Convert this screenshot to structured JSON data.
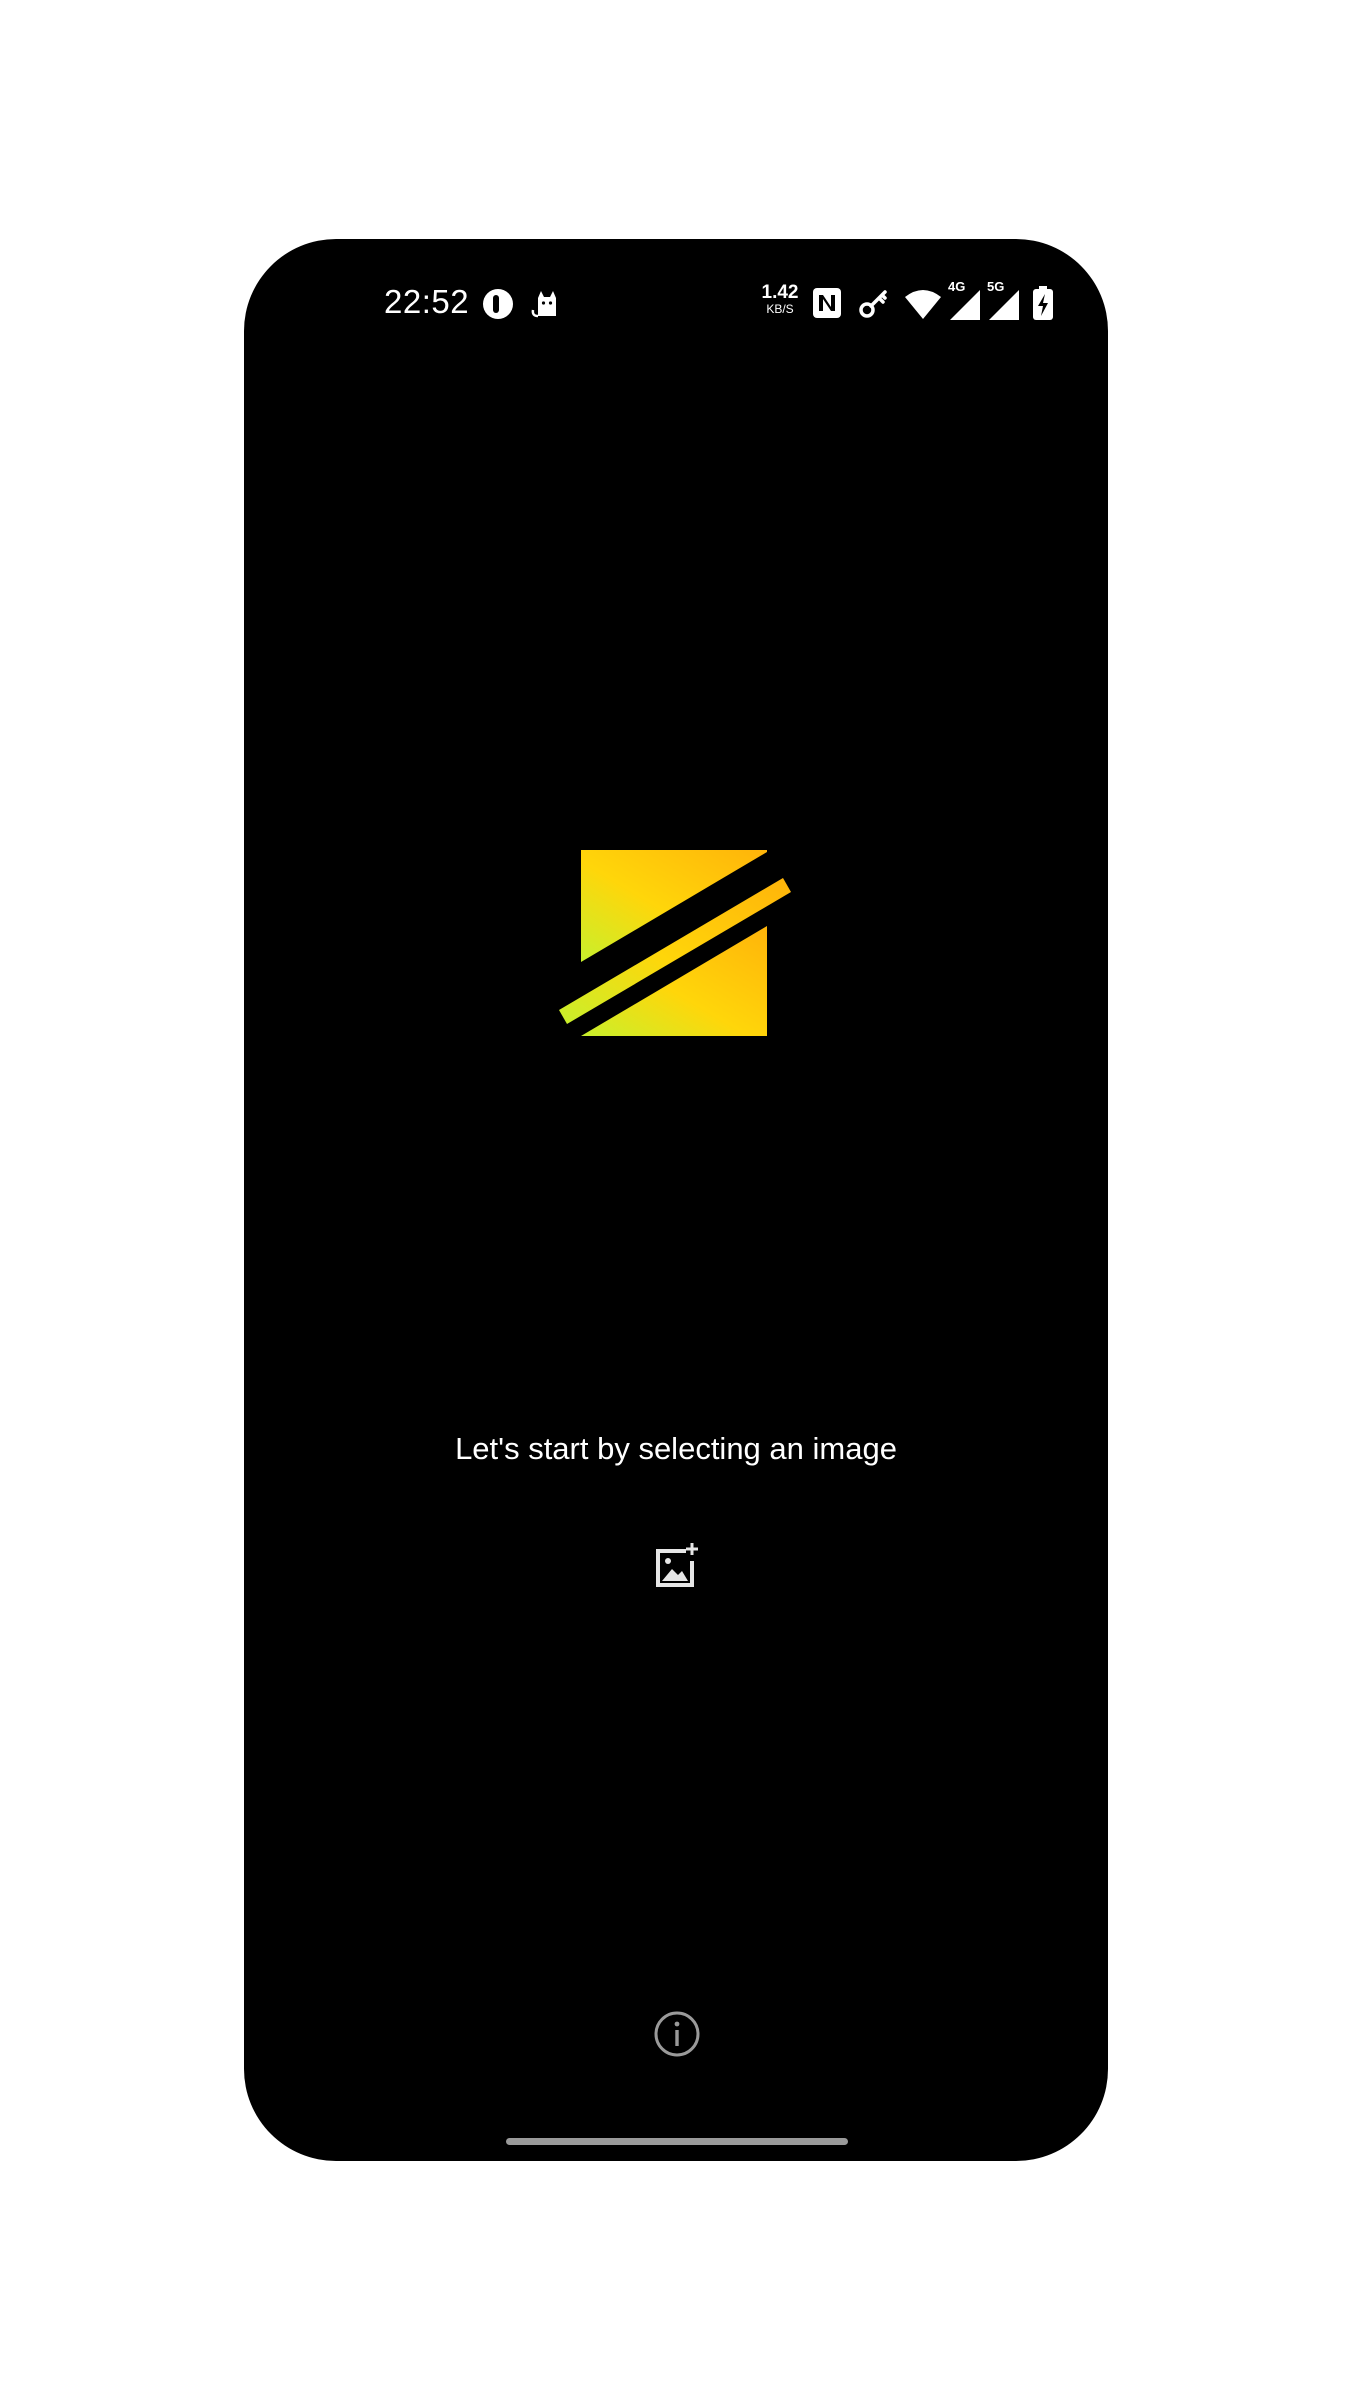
{
  "status_bar": {
    "time": "22:52",
    "net_speed_value": "1.42",
    "net_speed_unit": "KB/S",
    "network_label_1": "4G",
    "network_label_2": "5G",
    "icons": [
      "ring-icon",
      "cat-icon",
      "nfc-icon",
      "key-icon",
      "wifi-icon",
      "signal-4g-icon",
      "signal-5g-icon",
      "battery-charging-icon"
    ]
  },
  "main": {
    "prompt_text": "Let's start by selecting an image",
    "add_image_icon": "add-image-icon",
    "info_icon": "info-icon"
  },
  "colors": {
    "background": "#000000",
    "logo_gradient_start": "#c8f02c",
    "logo_gradient_mid": "#ffd60a",
    "logo_gradient_end": "#ffb40a",
    "text": "#ffffff",
    "muted": "#9a9a9a"
  }
}
